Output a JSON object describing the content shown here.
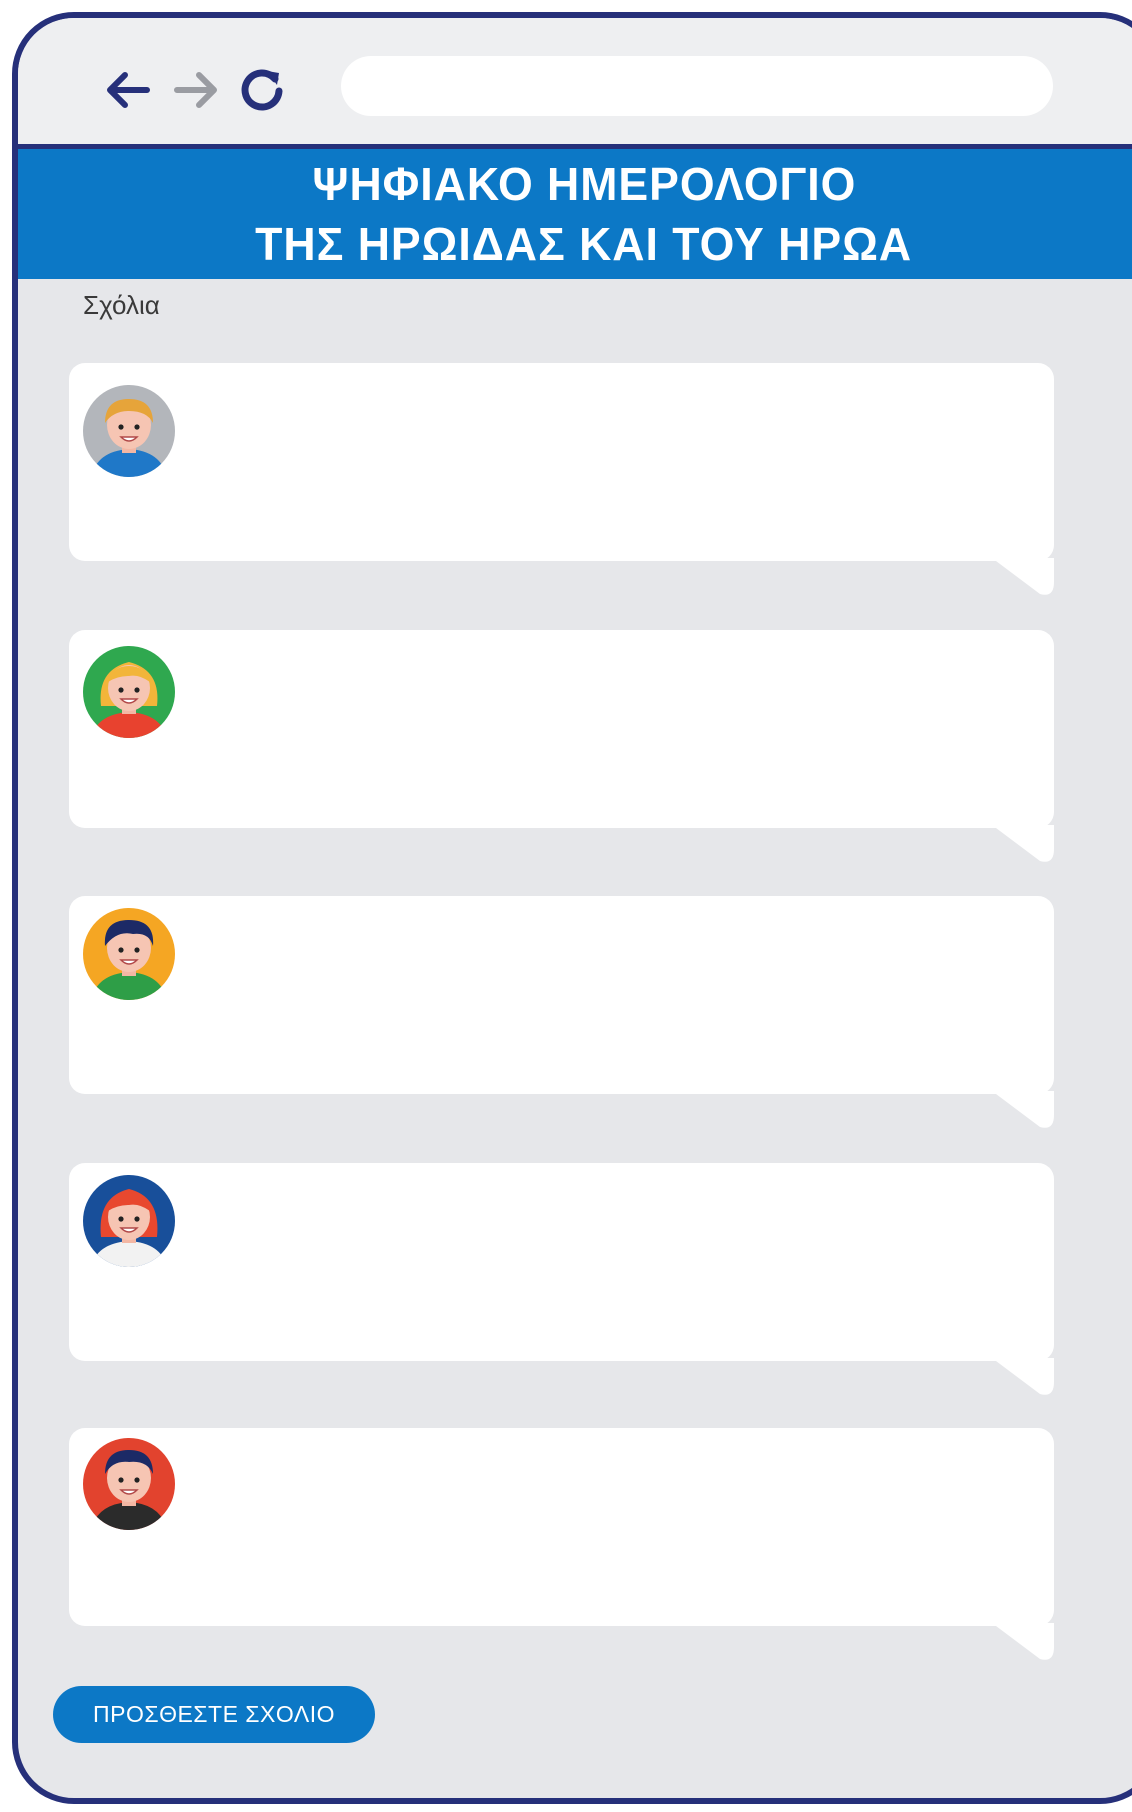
{
  "browser": {
    "nav_icons": [
      "back-arrow-icon",
      "forward-arrow-icon",
      "reload-icon"
    ],
    "url_value": ""
  },
  "header": {
    "line1": "ΨΗΦΙΑΚΟ ΗΜΕΡΟΛΟΓΙΟ",
    "line2": "ΤΗΣ ΗΡΩΙΔΑΣ ΚΑΙ ΤΟΥ ΗΡΩΑ"
  },
  "comments_section": {
    "label": "Σχόλια",
    "comments": [
      {
        "avatar": "boy-blond-avatar",
        "text": ""
      },
      {
        "avatar": "girl-blonde-avatar",
        "text": ""
      },
      {
        "avatar": "boy-dark-hair-avatar",
        "text": ""
      },
      {
        "avatar": "girl-red-hair-avatar",
        "text": ""
      },
      {
        "avatar": "boy-red-background-avatar",
        "text": ""
      }
    ]
  },
  "actions": {
    "add_comment_label": "ΠΡΟΣΘΕΣΤΕ ΣΧΟΛΙΟ"
  },
  "colors": {
    "frame": "#26307a",
    "header": "#0c78c6",
    "background": "#e6e7ea"
  }
}
